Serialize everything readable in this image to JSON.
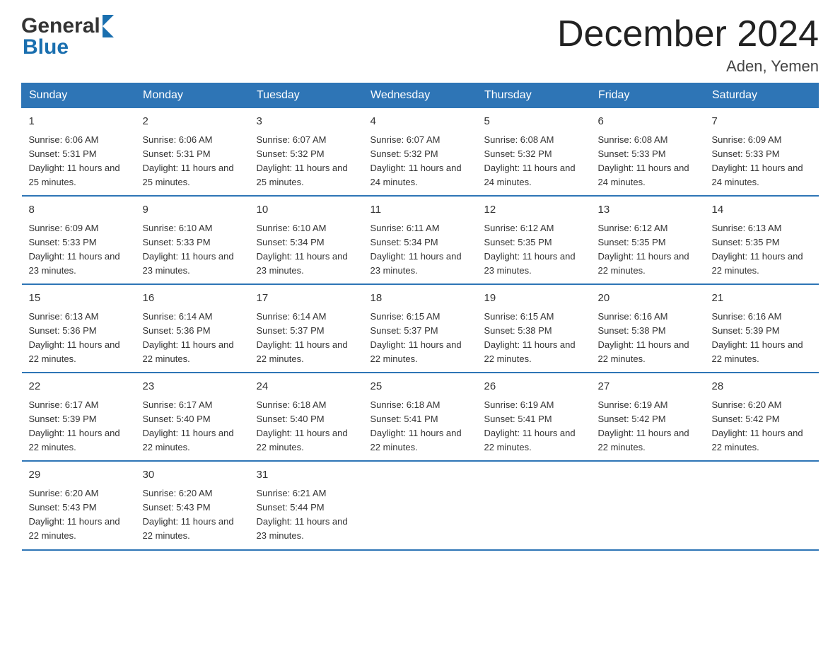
{
  "header": {
    "logo_general": "General",
    "logo_blue": "Blue",
    "title": "December 2024",
    "subtitle": "Aden, Yemen"
  },
  "weekdays": [
    "Sunday",
    "Monday",
    "Tuesday",
    "Wednesday",
    "Thursday",
    "Friday",
    "Saturday"
  ],
  "weeks": [
    [
      {
        "day": "1",
        "sunrise": "6:06 AM",
        "sunset": "5:31 PM",
        "daylight": "11 hours and 25 minutes."
      },
      {
        "day": "2",
        "sunrise": "6:06 AM",
        "sunset": "5:31 PM",
        "daylight": "11 hours and 25 minutes."
      },
      {
        "day": "3",
        "sunrise": "6:07 AM",
        "sunset": "5:32 PM",
        "daylight": "11 hours and 25 minutes."
      },
      {
        "day": "4",
        "sunrise": "6:07 AM",
        "sunset": "5:32 PM",
        "daylight": "11 hours and 24 minutes."
      },
      {
        "day": "5",
        "sunrise": "6:08 AM",
        "sunset": "5:32 PM",
        "daylight": "11 hours and 24 minutes."
      },
      {
        "day": "6",
        "sunrise": "6:08 AM",
        "sunset": "5:33 PM",
        "daylight": "11 hours and 24 minutes."
      },
      {
        "day": "7",
        "sunrise": "6:09 AM",
        "sunset": "5:33 PM",
        "daylight": "11 hours and 24 minutes."
      }
    ],
    [
      {
        "day": "8",
        "sunrise": "6:09 AM",
        "sunset": "5:33 PM",
        "daylight": "11 hours and 23 minutes."
      },
      {
        "day": "9",
        "sunrise": "6:10 AM",
        "sunset": "5:33 PM",
        "daylight": "11 hours and 23 minutes."
      },
      {
        "day": "10",
        "sunrise": "6:10 AM",
        "sunset": "5:34 PM",
        "daylight": "11 hours and 23 minutes."
      },
      {
        "day": "11",
        "sunrise": "6:11 AM",
        "sunset": "5:34 PM",
        "daylight": "11 hours and 23 minutes."
      },
      {
        "day": "12",
        "sunrise": "6:12 AM",
        "sunset": "5:35 PM",
        "daylight": "11 hours and 23 minutes."
      },
      {
        "day": "13",
        "sunrise": "6:12 AM",
        "sunset": "5:35 PM",
        "daylight": "11 hours and 22 minutes."
      },
      {
        "day": "14",
        "sunrise": "6:13 AM",
        "sunset": "5:35 PM",
        "daylight": "11 hours and 22 minutes."
      }
    ],
    [
      {
        "day": "15",
        "sunrise": "6:13 AM",
        "sunset": "5:36 PM",
        "daylight": "11 hours and 22 minutes."
      },
      {
        "day": "16",
        "sunrise": "6:14 AM",
        "sunset": "5:36 PM",
        "daylight": "11 hours and 22 minutes."
      },
      {
        "day": "17",
        "sunrise": "6:14 AM",
        "sunset": "5:37 PM",
        "daylight": "11 hours and 22 minutes."
      },
      {
        "day": "18",
        "sunrise": "6:15 AM",
        "sunset": "5:37 PM",
        "daylight": "11 hours and 22 minutes."
      },
      {
        "day": "19",
        "sunrise": "6:15 AM",
        "sunset": "5:38 PM",
        "daylight": "11 hours and 22 minutes."
      },
      {
        "day": "20",
        "sunrise": "6:16 AM",
        "sunset": "5:38 PM",
        "daylight": "11 hours and 22 minutes."
      },
      {
        "day": "21",
        "sunrise": "6:16 AM",
        "sunset": "5:39 PM",
        "daylight": "11 hours and 22 minutes."
      }
    ],
    [
      {
        "day": "22",
        "sunrise": "6:17 AM",
        "sunset": "5:39 PM",
        "daylight": "11 hours and 22 minutes."
      },
      {
        "day": "23",
        "sunrise": "6:17 AM",
        "sunset": "5:40 PM",
        "daylight": "11 hours and 22 minutes."
      },
      {
        "day": "24",
        "sunrise": "6:18 AM",
        "sunset": "5:40 PM",
        "daylight": "11 hours and 22 minutes."
      },
      {
        "day": "25",
        "sunrise": "6:18 AM",
        "sunset": "5:41 PM",
        "daylight": "11 hours and 22 minutes."
      },
      {
        "day": "26",
        "sunrise": "6:19 AM",
        "sunset": "5:41 PM",
        "daylight": "11 hours and 22 minutes."
      },
      {
        "day": "27",
        "sunrise": "6:19 AM",
        "sunset": "5:42 PM",
        "daylight": "11 hours and 22 minutes."
      },
      {
        "day": "28",
        "sunrise": "6:20 AM",
        "sunset": "5:42 PM",
        "daylight": "11 hours and 22 minutes."
      }
    ],
    [
      {
        "day": "29",
        "sunrise": "6:20 AM",
        "sunset": "5:43 PM",
        "daylight": "11 hours and 22 minutes."
      },
      {
        "day": "30",
        "sunrise": "6:20 AM",
        "sunset": "5:43 PM",
        "daylight": "11 hours and 22 minutes."
      },
      {
        "day": "31",
        "sunrise": "6:21 AM",
        "sunset": "5:44 PM",
        "daylight": "11 hours and 23 minutes."
      },
      null,
      null,
      null,
      null
    ]
  ],
  "labels": {
    "sunrise": "Sunrise:",
    "sunset": "Sunset:",
    "daylight": "Daylight:"
  }
}
